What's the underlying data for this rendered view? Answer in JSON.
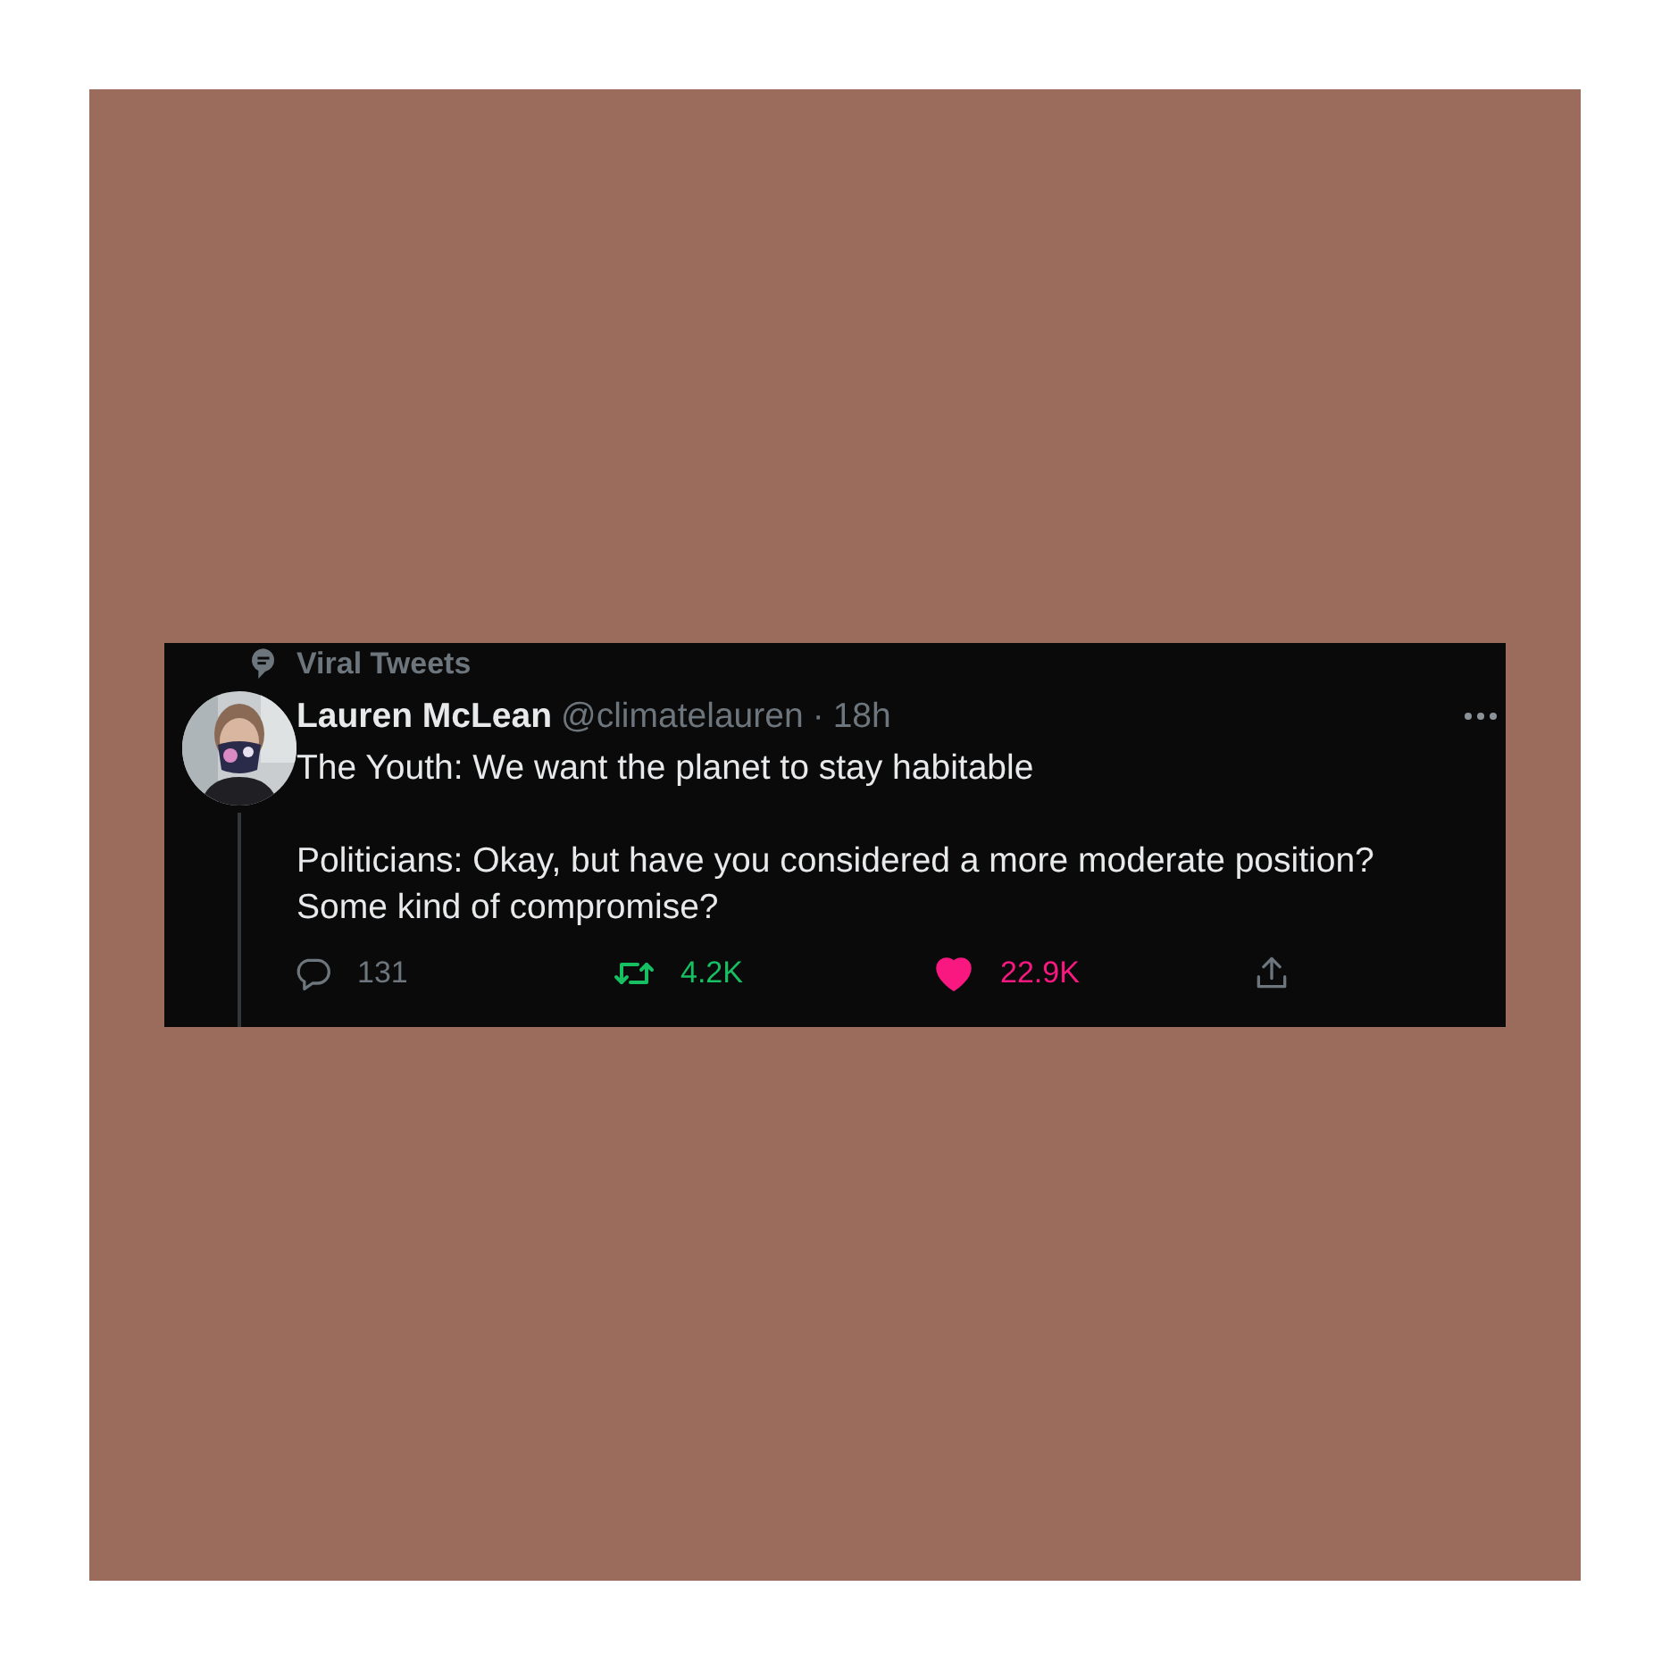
{
  "context": {
    "label": "Viral Tweets"
  },
  "tweet": {
    "name": "Lauren McLean",
    "handle": "@climatelauren",
    "separator": "·",
    "time": "18h",
    "paragraphs": [
      "The Youth: We want the planet to stay habitable",
      "Politicians: Okay, but have you considered a more moderate position? Some kind of compromise?"
    ],
    "actions": [
      {
        "kind": "reply",
        "count": "131"
      },
      {
        "kind": "retweet",
        "count": "4.2K",
        "active": true
      },
      {
        "kind": "like",
        "count": "22.9K",
        "active": true
      },
      {
        "kind": "share"
      }
    ]
  }
}
